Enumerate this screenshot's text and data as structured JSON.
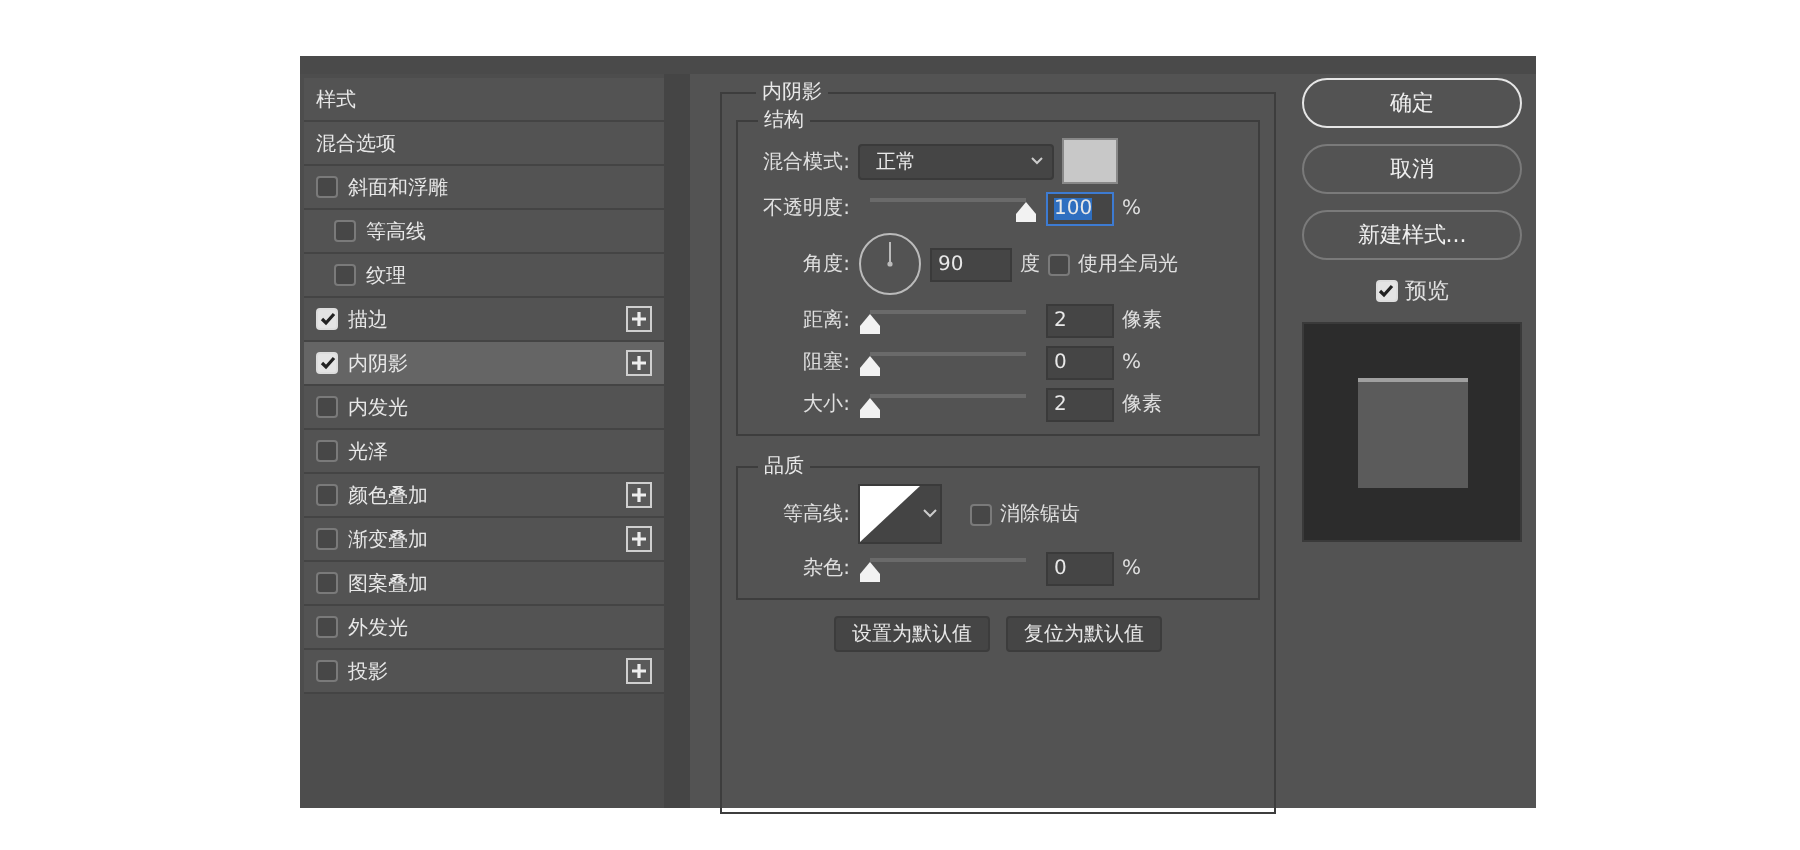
{
  "effects": [
    {
      "kind": "header",
      "label": "样式",
      "selected": false
    },
    {
      "kind": "header",
      "label": "混合选项",
      "selected": false
    },
    {
      "kind": "effect",
      "label": "斜面和浮雕",
      "checked": false,
      "selected": false,
      "addable": false,
      "children": [
        {
          "kind": "effect",
          "label": "等高线",
          "checked": false,
          "selected": false,
          "addable": false
        },
        {
          "kind": "effect",
          "label": "纹理",
          "checked": false,
          "selected": false,
          "addable": false
        }
      ]
    },
    {
      "kind": "effect",
      "label": "描边",
      "checked": true,
      "selected": false,
      "addable": true
    },
    {
      "kind": "effect",
      "label": "内阴影",
      "checked": true,
      "selected": true,
      "addable": true
    },
    {
      "kind": "effect",
      "label": "内发光",
      "checked": false,
      "selected": false,
      "addable": false
    },
    {
      "kind": "effect",
      "label": "光泽",
      "checked": false,
      "selected": false,
      "addable": false
    },
    {
      "kind": "effect",
      "label": "颜色叠加",
      "checked": false,
      "selected": false,
      "addable": true
    },
    {
      "kind": "effect",
      "label": "渐变叠加",
      "checked": false,
      "selected": false,
      "addable": true
    },
    {
      "kind": "effect",
      "label": "图案叠加",
      "checked": false,
      "selected": false,
      "addable": false
    },
    {
      "kind": "effect",
      "label": "外发光",
      "checked": false,
      "selected": false,
      "addable": false
    },
    {
      "kind": "effect",
      "label": "投影",
      "checked": false,
      "selected": false,
      "addable": true
    }
  ],
  "panel": {
    "title": "内阴影",
    "structure": {
      "title": "结构",
      "blend_label": "混合模式:",
      "blend_value": "正常",
      "opacity": {
        "label": "不透明度:",
        "level": 1,
        "value": "100",
        "unit": "%",
        "focused": true
      },
      "angle": {
        "label": "角度:",
        "value": "90",
        "unit": "度"
      },
      "global_light": {
        "label": "使用全局光",
        "checked": false
      },
      "sliders": [
        {
          "label": "距离:",
          "level": 0,
          "value": "2",
          "unit": "像素"
        },
        {
          "label": "阻塞:",
          "level": 0,
          "value": "0",
          "unit": "%"
        },
        {
          "label": "大小:",
          "level": 0,
          "value": "2",
          "unit": "像素"
        }
      ]
    },
    "quality": {
      "title": "品质",
      "contour_label": "等高线:",
      "anti_alias": {
        "label": "消除锯齿",
        "checked": false
      },
      "noise": {
        "label": "杂色:",
        "level": 0,
        "value": "0",
        "unit": "%"
      }
    },
    "buttons": [
      "设置为默认值",
      "复位为默认值"
    ]
  },
  "actions": [
    {
      "label": "确定",
      "default": true
    },
    {
      "label": "取消",
      "default": false
    },
    {
      "label": "新建样式...",
      "default": false
    }
  ],
  "preview": {
    "label": "预览",
    "checked": true
  }
}
